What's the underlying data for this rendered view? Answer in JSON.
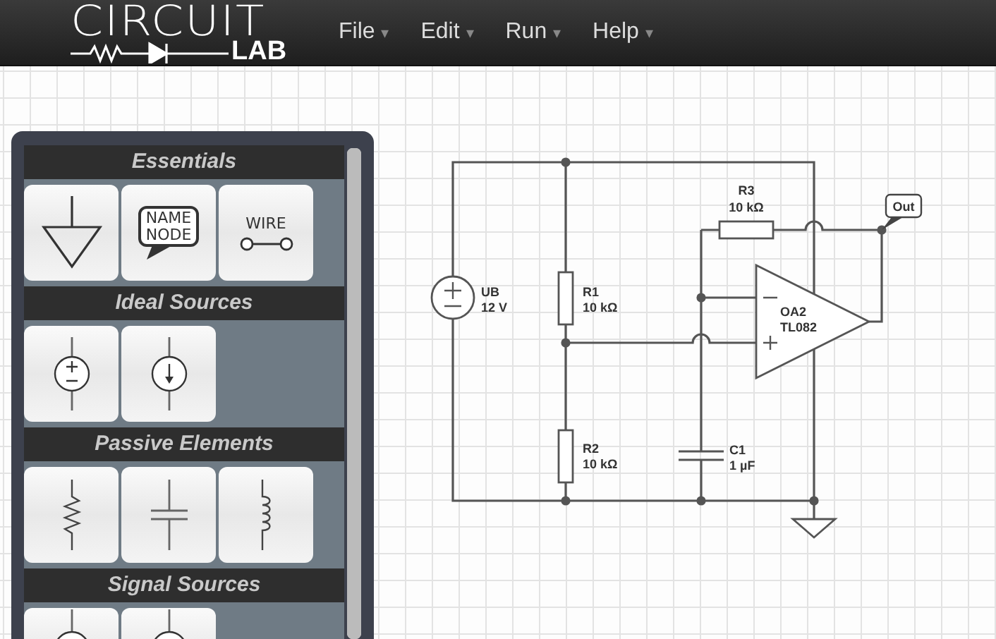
{
  "header": {
    "logo": {
      "top": "CIRCUIT",
      "bottom": "LAB"
    },
    "menus": [
      {
        "label": "File",
        "caret": "▾"
      },
      {
        "label": "Edit",
        "caret": "▾"
      },
      {
        "label": "Run",
        "caret": "▾"
      },
      {
        "label": "Help",
        "caret": "▾"
      }
    ]
  },
  "palette": {
    "sections": [
      {
        "title": "Essentials",
        "tiles": [
          {
            "kind": "ground"
          },
          {
            "kind": "name-node",
            "lines": [
              "NAME",
              "NODE"
            ]
          },
          {
            "kind": "wire",
            "text": "WIRE"
          }
        ]
      },
      {
        "title": "Ideal Sources",
        "tiles": [
          {
            "kind": "voltage-source"
          },
          {
            "kind": "current-source"
          }
        ]
      },
      {
        "title": "Passive Elements",
        "tiles": [
          {
            "kind": "resistor"
          },
          {
            "kind": "capacitor"
          },
          {
            "kind": "inductor"
          }
        ]
      },
      {
        "title": "Signal Sources",
        "tiles": [
          {
            "kind": "signal-source"
          },
          {
            "kind": "signal-source"
          }
        ]
      }
    ]
  },
  "schematic": {
    "components": [
      {
        "kind": "voltage-source",
        "name": "UB",
        "value": "12 V"
      },
      {
        "kind": "resistor",
        "name": "R1",
        "value": "10 kΩ"
      },
      {
        "kind": "resistor",
        "name": "R2",
        "value": "10 kΩ"
      },
      {
        "kind": "resistor",
        "name": "R3",
        "value": "10 kΩ"
      },
      {
        "kind": "capacitor",
        "name": "C1",
        "value": "1 µF"
      },
      {
        "kind": "opamp",
        "name": "OA2",
        "value": "TL082"
      },
      {
        "kind": "ground"
      },
      {
        "kind": "net-label",
        "text": "Out"
      }
    ]
  }
}
